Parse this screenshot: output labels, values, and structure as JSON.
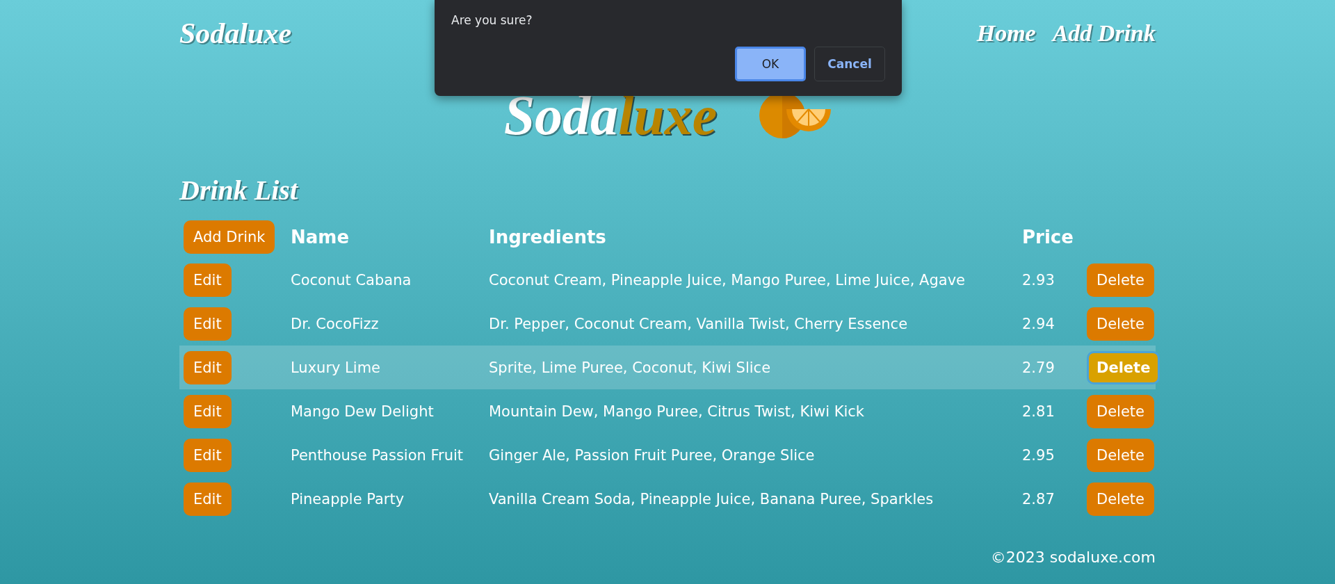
{
  "header": {
    "brand": "Sodaluxe",
    "nav": [
      "Home",
      "Add Drink"
    ]
  },
  "dialog": {
    "message": "Are you sure?",
    "buttons": [
      {
        "label": "OK",
        "kind": "primary"
      },
      {
        "label": "Cancel",
        "kind": "secondary"
      }
    ]
  },
  "hero_logo": {
    "first": "Soda",
    "second": "luxe"
  },
  "section_title": "Drink List",
  "table": {
    "add_button": "Add Drink",
    "columns": [
      "Name",
      "Ingredients",
      "Price"
    ],
    "rows": [
      {
        "edit": "Edit",
        "name": "Coconut Cabana",
        "ingredients": "Coconut Cream, Pineapple Juice, Mango Puree, Lime Juice, Agave",
        "price": "2.93",
        "delete": "Delete",
        "highlighted": false
      },
      {
        "edit": "Edit",
        "name": "Dr. CocoFizz",
        "ingredients": "Dr. Pepper, Coconut Cream, Vanilla Twist, Cherry Essence",
        "price": "2.94",
        "delete": "Delete",
        "highlighted": false
      },
      {
        "edit": "Edit",
        "name": "Luxury Lime",
        "ingredients": "Sprite, Lime Puree, Coconut, Kiwi Slice",
        "price": "2.79",
        "delete": "Delete",
        "highlighted": true
      },
      {
        "edit": "Edit",
        "name": "Mango Dew Delight",
        "ingredients": "Mountain Dew, Mango Puree, Citrus Twist, Kiwi Kick",
        "price": "2.81",
        "delete": "Delete",
        "highlighted": false
      },
      {
        "edit": "Edit",
        "name": "Penthouse Passion Fruit",
        "ingredients": "Ginger Ale, Passion Fruit Puree, Orange Slice",
        "price": "2.95",
        "delete": "Delete",
        "highlighted": false
      },
      {
        "edit": "Edit",
        "name": "Pineapple Party",
        "ingredients": "Vanilla Cream Soda, Pineapple Juice, Banana Puree, Sparkles",
        "price": "2.87",
        "delete": "Delete",
        "highlighted": false
      }
    ]
  },
  "footer": "©2023 sodaluxe.com"
}
